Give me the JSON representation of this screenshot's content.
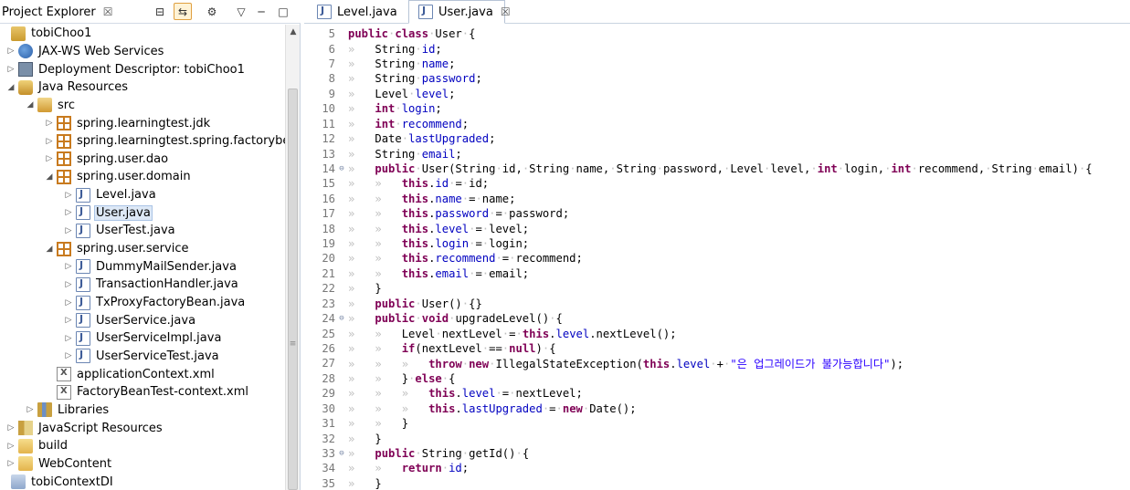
{
  "explorer": {
    "title": "Project Explorer",
    "close_glyph": "☒",
    "toolbar": [
      {
        "name": "collapse-all-icon",
        "glyph": "⊟"
      },
      {
        "name": "link-with-editor-icon",
        "glyph": "⇆"
      },
      {
        "name": "focus-icon",
        "glyph": "⚙"
      },
      {
        "name": "view-menu-icon",
        "glyph": "▽"
      },
      {
        "name": "minimize-icon",
        "glyph": "─"
      },
      {
        "name": "maximize-icon",
        "glyph": "□"
      }
    ],
    "tree": [
      {
        "label": "tobiChoo1",
        "depth": 0,
        "twisty": "",
        "icon": "project"
      },
      {
        "label": "JAX-WS Web Services",
        "depth": 1,
        "twisty": "▷",
        "icon": "jaxws"
      },
      {
        "label": "Deployment Descriptor: tobiChoo1",
        "depth": 1,
        "twisty": "▷",
        "icon": "deploy"
      },
      {
        "label": "Java Resources",
        "depth": 1,
        "twisty": "◢",
        "icon": "resources"
      },
      {
        "label": "src",
        "depth": 2,
        "twisty": "◢",
        "icon": "src"
      },
      {
        "label": "spring.learningtest.jdk",
        "depth": 3,
        "twisty": "▷",
        "icon": "pkg"
      },
      {
        "label": "spring.learningtest.spring.factorybean",
        "depth": 3,
        "twisty": "▷",
        "icon": "pkg"
      },
      {
        "label": "spring.user.dao",
        "depth": 3,
        "twisty": "▷",
        "icon": "pkg"
      },
      {
        "label": "spring.user.domain",
        "depth": 3,
        "twisty": "◢",
        "icon": "pkg"
      },
      {
        "label": "Level.java",
        "depth": 4,
        "twisty": "▷",
        "icon": "java"
      },
      {
        "label": "User.java",
        "depth": 4,
        "twisty": "▷",
        "icon": "java",
        "selected": true
      },
      {
        "label": "UserTest.java",
        "depth": 4,
        "twisty": "▷",
        "icon": "java"
      },
      {
        "label": "spring.user.service",
        "depth": 3,
        "twisty": "◢",
        "icon": "pkg"
      },
      {
        "label": "DummyMailSender.java",
        "depth": 4,
        "twisty": "▷",
        "icon": "java"
      },
      {
        "label": "TransactionHandler.java",
        "depth": 4,
        "twisty": "▷",
        "icon": "java"
      },
      {
        "label": "TxProxyFactoryBean.java",
        "depth": 4,
        "twisty": "▷",
        "icon": "java"
      },
      {
        "label": "UserService.java",
        "depth": 4,
        "twisty": "▷",
        "icon": "java"
      },
      {
        "label": "UserServiceImpl.java",
        "depth": 4,
        "twisty": "▷",
        "icon": "java"
      },
      {
        "label": "UserServiceTest.java",
        "depth": 4,
        "twisty": "▷",
        "icon": "java"
      },
      {
        "label": "applicationContext.xml",
        "depth": 3,
        "twisty": "",
        "icon": "xml"
      },
      {
        "label": "FactoryBeanTest-context.xml",
        "depth": 3,
        "twisty": "",
        "icon": "xml"
      },
      {
        "label": "Libraries",
        "depth": 2,
        "twisty": "▷",
        "icon": "lib"
      },
      {
        "label": "JavaScript Resources",
        "depth": 1,
        "twisty": "▷",
        "icon": "js"
      },
      {
        "label": "build",
        "depth": 1,
        "twisty": "▷",
        "icon": "folder"
      },
      {
        "label": "WebContent",
        "depth": 1,
        "twisty": "▷",
        "icon": "folder"
      },
      {
        "label": "tobiContextDI",
        "depth": 0,
        "twisty": "",
        "icon": "ctxproj"
      }
    ]
  },
  "editor": {
    "tabs": [
      {
        "label": "Level.java",
        "active": false
      },
      {
        "label": "User.java",
        "active": true
      }
    ],
    "close_glyph": "☒",
    "lines": [
      {
        "n": "5",
        "fold": "",
        "ind": "",
        "tokens": [
          [
            "kw",
            "public"
          ],
          [
            "ws",
            "·"
          ],
          [
            "kw",
            "class"
          ],
          [
            "ws",
            "·"
          ],
          [
            "",
            "User"
          ],
          [
            "ws",
            "·"
          ],
          [
            "",
            "{"
          ]
        ]
      },
      {
        "n": "6",
        "fold": "",
        "ind": "»   ",
        "tokens": [
          [
            "",
            "String"
          ],
          [
            "ws",
            "·"
          ],
          [
            "fld",
            "id"
          ],
          [
            "",
            ";"
          ]
        ]
      },
      {
        "n": "7",
        "fold": "",
        "ind": "»   ",
        "tokens": [
          [
            "",
            "String"
          ],
          [
            "ws",
            "·"
          ],
          [
            "fld",
            "name"
          ],
          [
            "",
            ";"
          ]
        ]
      },
      {
        "n": "8",
        "fold": "",
        "ind": "»   ",
        "tokens": [
          [
            "",
            "String"
          ],
          [
            "ws",
            "·"
          ],
          [
            "fld",
            "password"
          ],
          [
            "",
            ";"
          ]
        ]
      },
      {
        "n": "9",
        "fold": "",
        "ind": "»   ",
        "tokens": [
          [
            "",
            "Level"
          ],
          [
            "ws",
            "·"
          ],
          [
            "fld",
            "level"
          ],
          [
            "",
            ";"
          ]
        ]
      },
      {
        "n": "10",
        "fold": "",
        "ind": "»   ",
        "tokens": [
          [
            "kw",
            "int"
          ],
          [
            "ws",
            "·"
          ],
          [
            "fld",
            "login"
          ],
          [
            "",
            ";"
          ]
        ]
      },
      {
        "n": "11",
        "fold": "",
        "ind": "»   ",
        "tokens": [
          [
            "kw",
            "int"
          ],
          [
            "ws",
            "·"
          ],
          [
            "fld",
            "recommend"
          ],
          [
            "",
            ";"
          ]
        ]
      },
      {
        "n": "12",
        "fold": "",
        "ind": "»   ",
        "tokens": [
          [
            "",
            "Date"
          ],
          [
            "ws",
            "·"
          ],
          [
            "fld",
            "lastUpgraded"
          ],
          [
            "",
            ";"
          ]
        ]
      },
      {
        "n": "13",
        "fold": "",
        "ind": "»   ",
        "tokens": [
          [
            "",
            "String"
          ],
          [
            "ws",
            "·"
          ],
          [
            "fld",
            "email"
          ],
          [
            "",
            ";"
          ]
        ]
      },
      {
        "n": "14",
        "fold": "⊖",
        "ind": "»   ",
        "tokens": [
          [
            "kw",
            "public"
          ],
          [
            "ws",
            "·"
          ],
          [
            "",
            "User(String"
          ],
          [
            "ws",
            "·"
          ],
          [
            "",
            "id,"
          ],
          [
            "ws",
            "·"
          ],
          [
            "",
            "String"
          ],
          [
            "ws",
            "·"
          ],
          [
            "",
            "name,"
          ],
          [
            "ws",
            "·"
          ],
          [
            "",
            "String"
          ],
          [
            "ws",
            "·"
          ],
          [
            "",
            "password,"
          ],
          [
            "ws",
            "·"
          ],
          [
            "",
            "Level"
          ],
          [
            "ws",
            "·"
          ],
          [
            "",
            "level,"
          ],
          [
            "ws",
            "·"
          ],
          [
            "kw",
            "int"
          ],
          [
            "ws",
            "·"
          ],
          [
            "",
            "login,"
          ],
          [
            "ws",
            "·"
          ],
          [
            "kw",
            "int"
          ],
          [
            "ws",
            "·"
          ],
          [
            "",
            "recommend,"
          ],
          [
            "ws",
            "·"
          ],
          [
            "",
            "String"
          ],
          [
            "ws",
            "·"
          ],
          [
            "",
            "email)"
          ],
          [
            "ws",
            "·"
          ],
          [
            "",
            "{"
          ]
        ]
      },
      {
        "n": "15",
        "fold": "",
        "ind": "»   »   ",
        "tokens": [
          [
            "kw",
            "this"
          ],
          [
            "",
            ".",
            ""
          ],
          [
            "fld",
            "id"
          ],
          [
            "ws",
            "·"
          ],
          [
            "",
            "="
          ],
          [
            "ws",
            "·"
          ],
          [
            "",
            "id;"
          ]
        ]
      },
      {
        "n": "16",
        "fold": "",
        "ind": "»   »   ",
        "tokens": [
          [
            "kw",
            "this"
          ],
          [
            "",
            "."
          ],
          [
            "fld",
            "name"
          ],
          [
            "ws",
            "·"
          ],
          [
            "",
            "="
          ],
          [
            "ws",
            "·"
          ],
          [
            "",
            "name;"
          ]
        ]
      },
      {
        "n": "17",
        "fold": "",
        "ind": "»   »   ",
        "tokens": [
          [
            "kw",
            "this"
          ],
          [
            "",
            "."
          ],
          [
            "fld",
            "password"
          ],
          [
            "ws",
            "·"
          ],
          [
            "",
            "="
          ],
          [
            "ws",
            "·"
          ],
          [
            "",
            "password;"
          ]
        ]
      },
      {
        "n": "18",
        "fold": "",
        "ind": "»   »   ",
        "tokens": [
          [
            "kw",
            "this"
          ],
          [
            "",
            "."
          ],
          [
            "fld",
            "level"
          ],
          [
            "ws",
            "·"
          ],
          [
            "",
            "="
          ],
          [
            "ws",
            "·"
          ],
          [
            "",
            "level;"
          ]
        ]
      },
      {
        "n": "19",
        "fold": "",
        "ind": "»   »   ",
        "tokens": [
          [
            "kw",
            "this"
          ],
          [
            "",
            "."
          ],
          [
            "fld",
            "login"
          ],
          [
            "ws",
            "·"
          ],
          [
            "",
            "="
          ],
          [
            "ws",
            "·"
          ],
          [
            "",
            "login;"
          ]
        ]
      },
      {
        "n": "20",
        "fold": "",
        "ind": "»   »   ",
        "tokens": [
          [
            "kw",
            "this"
          ],
          [
            "",
            "."
          ],
          [
            "fld",
            "recommend"
          ],
          [
            "ws",
            "·"
          ],
          [
            "",
            "="
          ],
          [
            "ws",
            "·"
          ],
          [
            "",
            "recommend;"
          ]
        ]
      },
      {
        "n": "21",
        "fold": "",
        "ind": "»   »   ",
        "tokens": [
          [
            "kw",
            "this"
          ],
          [
            "",
            "."
          ],
          [
            "fld",
            "email"
          ],
          [
            "ws",
            "·"
          ],
          [
            "",
            "="
          ],
          [
            "ws",
            "·"
          ],
          [
            "",
            "email;"
          ]
        ]
      },
      {
        "n": "22",
        "fold": "",
        "ind": "»   ",
        "tokens": [
          [
            "",
            "}"
          ]
        ]
      },
      {
        "n": "23",
        "fold": "",
        "ind": "»   ",
        "tokens": [
          [
            "kw",
            "public"
          ],
          [
            "ws",
            "·"
          ],
          [
            "",
            "User()"
          ],
          [
            "ws",
            "·"
          ],
          [
            "",
            "{}"
          ]
        ]
      },
      {
        "n": "24",
        "fold": "⊖",
        "ind": "»   ",
        "tokens": [
          [
            "kw",
            "public"
          ],
          [
            "ws",
            "·"
          ],
          [
            "kw",
            "void"
          ],
          [
            "ws",
            "·"
          ],
          [
            "",
            "upgradeLevel()"
          ],
          [
            "ws",
            "·"
          ],
          [
            "",
            "{"
          ]
        ]
      },
      {
        "n": "25",
        "fold": "",
        "ind": "»   »   ",
        "tokens": [
          [
            "",
            "Level"
          ],
          [
            "ws",
            "·"
          ],
          [
            "",
            "nextLevel"
          ],
          [
            "ws",
            "·"
          ],
          [
            "",
            "="
          ],
          [
            "ws",
            "·"
          ],
          [
            "kw",
            "this"
          ],
          [
            "",
            "."
          ],
          [
            "fld",
            "level"
          ],
          [
            "",
            ".nextLevel();"
          ]
        ]
      },
      {
        "n": "26",
        "fold": "",
        "ind": "»   »   ",
        "tokens": [
          [
            "kw",
            "if"
          ],
          [
            "",
            "(nextLevel"
          ],
          [
            "ws",
            "·"
          ],
          [
            "",
            "=="
          ],
          [
            "ws",
            "·"
          ],
          [
            "kw",
            "null"
          ],
          [
            "",
            ")"
          ],
          [
            "ws",
            "·"
          ],
          [
            "",
            "{"
          ]
        ]
      },
      {
        "n": "27",
        "fold": "",
        "ind": "»   »   »   ",
        "tokens": [
          [
            "kw",
            "throw"
          ],
          [
            "ws",
            "·"
          ],
          [
            "kw",
            "new"
          ],
          [
            "ws",
            "·"
          ],
          [
            "",
            "IllegalStateException("
          ],
          [
            "kw",
            "this"
          ],
          [
            "",
            "."
          ],
          [
            "fld",
            "level"
          ],
          [
            "ws",
            "·"
          ],
          [
            "",
            "+"
          ],
          [
            "ws",
            "·"
          ],
          [
            "str",
            "\"은 업그레이드가 불가능합니다\""
          ],
          [
            "",
            ");"
          ]
        ]
      },
      {
        "n": "28",
        "fold": "",
        "ind": "»   »   ",
        "tokens": [
          [
            "",
            "}"
          ],
          [
            "ws",
            "·"
          ],
          [
            "kw",
            "else"
          ],
          [
            "ws",
            "·"
          ],
          [
            "",
            "{"
          ]
        ]
      },
      {
        "n": "29",
        "fold": "",
        "ind": "»   »   »   ",
        "tokens": [
          [
            "kw",
            "this"
          ],
          [
            "",
            "."
          ],
          [
            "fld",
            "level"
          ],
          [
            "ws",
            "·"
          ],
          [
            "",
            "="
          ],
          [
            "ws",
            "·"
          ],
          [
            "",
            "nextLevel;"
          ]
        ]
      },
      {
        "n": "30",
        "fold": "",
        "ind": "»   »   »   ",
        "tokens": [
          [
            "kw",
            "this"
          ],
          [
            "",
            "."
          ],
          [
            "fld",
            "lastUpgraded"
          ],
          [
            "ws",
            "·"
          ],
          [
            "",
            "="
          ],
          [
            "ws",
            "·"
          ],
          [
            "kw",
            "new"
          ],
          [
            "ws",
            "·"
          ],
          [
            "",
            "Date();"
          ]
        ]
      },
      {
        "n": "31",
        "fold": "",
        "ind": "»   »   ",
        "tokens": [
          [
            "",
            "}"
          ]
        ]
      },
      {
        "n": "32",
        "fold": "",
        "ind": "»   ",
        "tokens": [
          [
            "",
            "}"
          ]
        ]
      },
      {
        "n": "33",
        "fold": "⊖",
        "ind": "»   ",
        "tokens": [
          [
            "kw",
            "public"
          ],
          [
            "ws",
            "·"
          ],
          [
            "",
            "String"
          ],
          [
            "ws",
            "·"
          ],
          [
            "",
            "getId()"
          ],
          [
            "ws",
            "·"
          ],
          [
            "",
            "{"
          ]
        ]
      },
      {
        "n": "34",
        "fold": "",
        "ind": "»   »   ",
        "tokens": [
          [
            "kw",
            "return"
          ],
          [
            "ws",
            "·"
          ],
          [
            "fld",
            "id"
          ],
          [
            "",
            ";"
          ]
        ]
      },
      {
        "n": "35",
        "fold": "",
        "ind": "»   ",
        "tokens": [
          [
            "",
            "}"
          ]
        ]
      }
    ]
  },
  "colors": {
    "keyword": "#7f0055",
    "field": "#0000c0",
    "string": "#2a00ff",
    "whitespace_marker": "#c0c0c0",
    "line_number": "#787878",
    "selection": "#dde8f6"
  }
}
